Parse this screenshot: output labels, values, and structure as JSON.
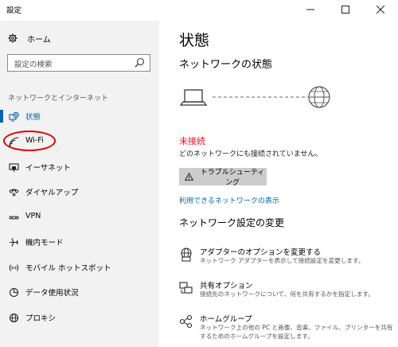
{
  "window": {
    "title": "設定"
  },
  "sidebar": {
    "home_label": "ホーム",
    "search_placeholder": "設定の検索",
    "section_label": "ネットワークとインターネット",
    "items": [
      {
        "label": "状態",
        "icon": "globe-monitor-icon",
        "active": true
      },
      {
        "label": "Wi-Fi",
        "icon": "wifi-icon",
        "active": false
      },
      {
        "label": "イーサネット",
        "icon": "ethernet-icon",
        "active": false
      },
      {
        "label": "ダイヤルアップ",
        "icon": "dialup-icon",
        "active": false
      },
      {
        "label": "VPN",
        "icon": "vpn-icon",
        "active": false
      },
      {
        "label": "機内モード",
        "icon": "airplane-icon",
        "active": false
      },
      {
        "label": "モバイル ホットスポット",
        "icon": "hotspot-icon",
        "active": false
      },
      {
        "label": "データ使用状況",
        "icon": "data-usage-icon",
        "active": false
      },
      {
        "label": "プロキシ",
        "icon": "proxy-globe-icon",
        "active": false
      }
    ]
  },
  "main": {
    "title": "状態",
    "network_status_heading": "ネットワークの状態",
    "status_title": "未接続",
    "status_desc": "どのネットワークにも接続されていません。",
    "troubleshoot_label": "トラブルシューティング",
    "available_networks_link": "利用できるネットワークの表示",
    "change_settings_heading": "ネットワーク設定の変更",
    "options": [
      {
        "title": "アダプターのオプションを変更する",
        "desc": "ネットワーク アダプターを表示して接続設定を変更します。",
        "icon": "adapter-icon"
      },
      {
        "title": "共有オプション",
        "desc": "接続先のネットワークについて、何を共有するかを指定します。",
        "icon": "sharing-icon"
      },
      {
        "title": "ホームグループ",
        "desc": "ネットワーク上の他の PC と画像、音楽、ファイル、プリンターを共有するためのホームグループを設定します。",
        "icon": "homegroup-icon"
      }
    ]
  },
  "colors": {
    "accent": "#0063b1",
    "error": "#e81123",
    "sidebar_bg": "#f2f2f2",
    "button_bg": "#cccccc",
    "highlight_oval": "#e00000"
  }
}
